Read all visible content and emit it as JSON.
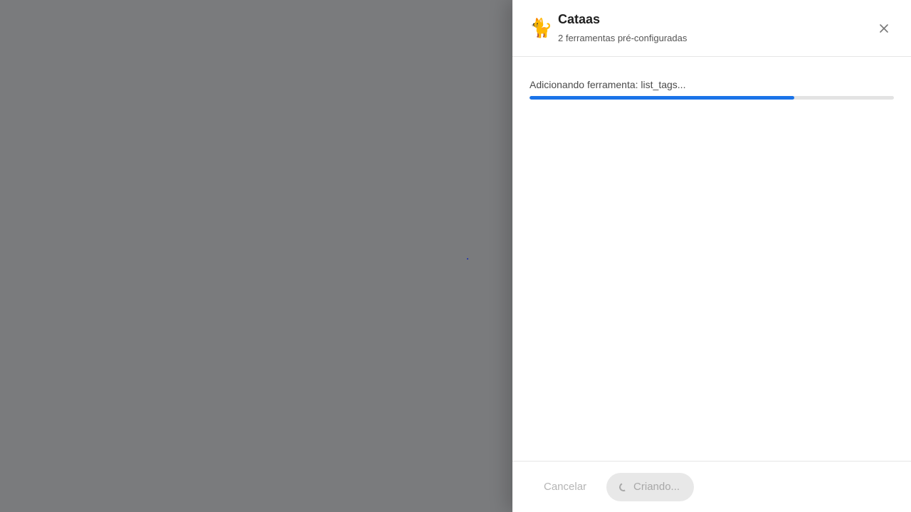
{
  "drawer": {
    "icon": "🐈",
    "icon_name": "cat-icon",
    "title": "Cataas",
    "subtitle": "2 ferramentas pré-configuradas",
    "close_icon": "close-icon"
  },
  "progress": {
    "label": "Adicionando ferramenta: list_tags...",
    "fraction": 0.727,
    "fill_color": "#1a73e8",
    "track_color": "#e3e3e3"
  },
  "footer": {
    "cancel_label": "Cancelar",
    "create_label": "Criando...",
    "create_icon": "spinner-icon"
  }
}
